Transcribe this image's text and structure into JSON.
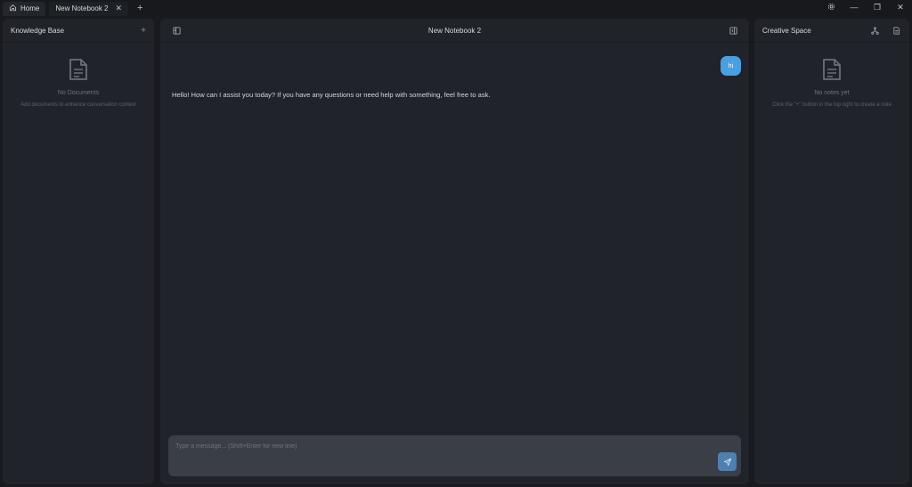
{
  "tabs": {
    "home_label": "Home",
    "notebook_label": "New Notebook 2",
    "close_glyph": "✕",
    "add_glyph": "+"
  },
  "window_controls": {
    "settings_icon": "gear-icon",
    "minimize": "—",
    "restore": "❐",
    "close": "✕"
  },
  "knowledge_base": {
    "title": "Knowledge Base",
    "add_glyph": "+",
    "empty_title": "No Documents",
    "empty_subtitle": "Add documents to enhance conversation context"
  },
  "notebook": {
    "title": "New Notebook 2",
    "messages": [
      {
        "role": "user",
        "text": "hi"
      },
      {
        "role": "assistant",
        "text": "Hello! How can I assist you today? If you have any questions or need help with something, feel free to ask."
      }
    ],
    "input_value": "",
    "input_placeholder": "Type a message... (Shift+Enter for new line)"
  },
  "creative_space": {
    "title": "Creative Space",
    "empty_title": "No notes yet",
    "empty_subtitle": "Click the \"+\" button in the top right to create a note"
  },
  "colors": {
    "accent": "#4a9fe0",
    "send_button": "#4f7fae",
    "panel_bg": "#20232a",
    "app_bg": "#181a1f"
  }
}
